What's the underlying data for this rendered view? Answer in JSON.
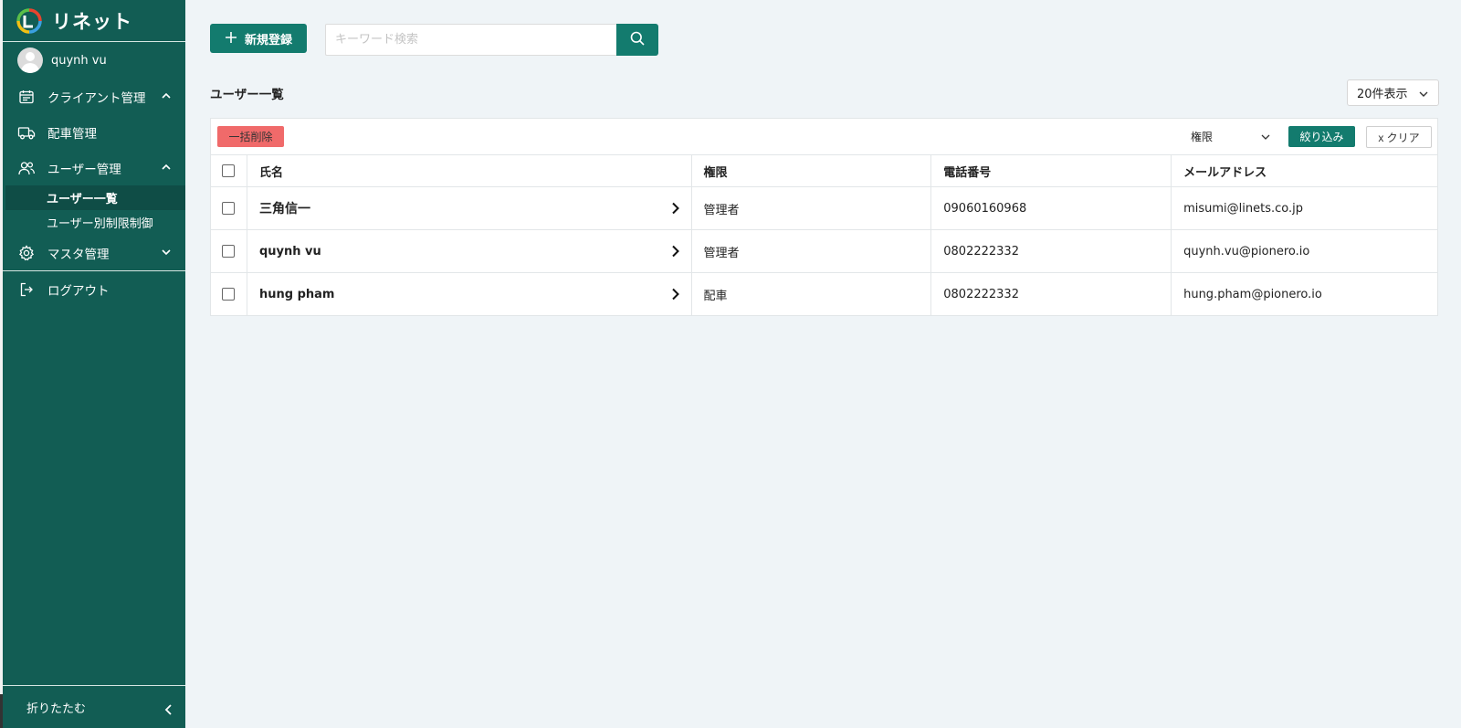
{
  "sidebar": {
    "logo_text": "リネット",
    "user_name": "quynh vu",
    "nav": {
      "client": "クライアント管理",
      "dispatch": "配車管理",
      "users": "ユーザー管理",
      "users_sub": [
        "ユーザー一覧",
        "ユーザー別制限制御"
      ],
      "master": "マスタ管理",
      "logout": "ログアウト"
    },
    "collapse_label": "折りたたむ"
  },
  "toolbar": {
    "new_button": "新規登録",
    "search_placeholder": "キーワード検索",
    "search_value": ""
  },
  "page": {
    "title": "ユーザー一覧",
    "per_page": "20件表示"
  },
  "filter_bar": {
    "bulk_delete": "一括削除",
    "role_filter": "権限",
    "filter_button": "絞り込み",
    "clear_button": "x クリア"
  },
  "table": {
    "headers": [
      "氏名",
      "権限",
      "電話番号",
      "メールアドレス"
    ],
    "rows": [
      {
        "name": "三角信一",
        "role": "管理者",
        "phone": "09060160968",
        "email": "misumi@linets.co.jp"
      },
      {
        "name": "quynh vu",
        "role": "管理者",
        "phone": "0802222332",
        "email": "quynh.vu@pionero.io"
      },
      {
        "name": "hung pham",
        "role": "配車",
        "phone": "0802222332",
        "email": "hung.pham@pionero.io"
      }
    ]
  },
  "colors": {
    "sidebar_bg": "#125d54",
    "primary": "#137b6e",
    "danger": "#f06a6a",
    "page_bg": "#eff4f7"
  },
  "icons": {
    "logo": "rinet-logo-icon",
    "client": "calendar-icon",
    "dispatch": "truck-icon",
    "users": "users-icon",
    "master": "gear-icon",
    "logout": "logout-icon"
  }
}
